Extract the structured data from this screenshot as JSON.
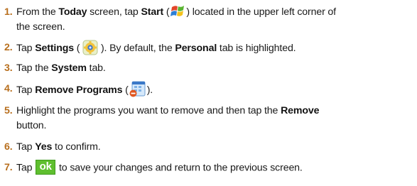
{
  "steps": [
    {
      "number": "1.",
      "parts": [
        "From the ",
        "Today",
        " screen, tap ",
        "Start",
        " (",
        ") located in the upper left corner of",
        "the screen."
      ]
    },
    {
      "number": "2.",
      "parts": [
        "Tap ",
        "Settings",
        " ( ",
        " ). By default, the ",
        "Personal",
        " tab is highlighted."
      ]
    },
    {
      "number": "3.",
      "parts": [
        "Tap the ",
        "System",
        " tab."
      ]
    },
    {
      "number": "4.",
      "parts": [
        "Tap ",
        "Remove Programs",
        " (",
        ")."
      ]
    },
    {
      "number": "5.",
      "parts": [
        "Highlight the programs you want to remove and then tap the ",
        "Remove",
        "button."
      ]
    },
    {
      "number": "6.",
      "parts": [
        "Tap ",
        "Yes",
        " to confirm."
      ]
    },
    {
      "number": "7.",
      "parts": [
        "Tap ",
        "ok",
        " to save your changes and return to the previous screen."
      ]
    }
  ],
  "colors": {
    "step_number": "#b86f1e",
    "ok_button": "#5fbf2f"
  },
  "icons": {
    "start": "windows-start-flag-icon",
    "settings": "settings-gear-icon",
    "remove_programs": "remove-programs-icon",
    "ok": "ok-button-icon"
  }
}
